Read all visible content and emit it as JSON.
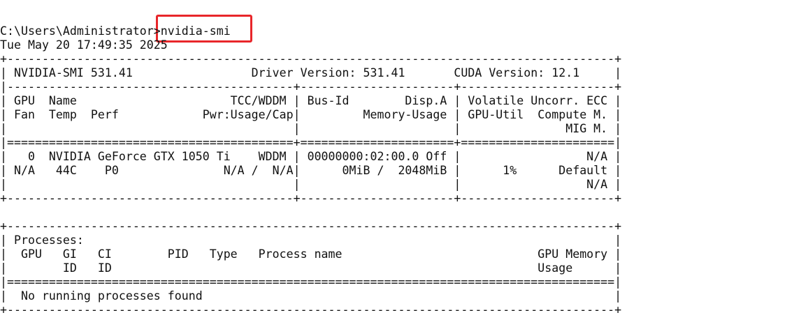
{
  "terminal": {
    "prompt": "C:\\Users\\Administrator>",
    "command": "nvidia-smi",
    "timestamp": "Tue May 20 17:49:35 2025",
    "lines": [
      "+---------------------------------------------------------------------------------------+",
      "| NVIDIA-SMI 531.41                 Driver Version: 531.41       CUDA Version: 12.1     |",
      "|-----------------------------------------+----------------------+----------------------+",
      "| GPU  Name                      TCC/WDDM | Bus-Id        Disp.A | Volatile Uncorr. ECC |",
      "| Fan  Temp  Perf            Pwr:Usage/Cap|         Memory-Usage | GPU-Util  Compute M. |",
      "|                                         |                      |               MIG M. |",
      "|=========================================+======================+======================|",
      "|   0  NVIDIA GeForce GTX 1050 Ti    WDDM | 00000000:02:00.0 Off |                  N/A |",
      "| N/A   44C    P0               N/A /  N/A|      0MiB /  2048MiB |      1%      Default |",
      "|                                         |                      |                  N/A |",
      "+-----------------------------------------+----------------------+----------------------+",
      "",
      "+---------------------------------------------------------------------------------------+",
      "| Processes:                                                                            |",
      "|  GPU   GI   CI        PID   Type   Process name                            GPU Memory |",
      "|        ID   ID                                                             Usage      |",
      "|=======================================================================================|",
      "|  No running processes found                                                           |",
      "+---------------------------------------------------------------------------------------+"
    ]
  },
  "highlight": {
    "color": "#e8262a",
    "target": "nvidia-smi"
  }
}
